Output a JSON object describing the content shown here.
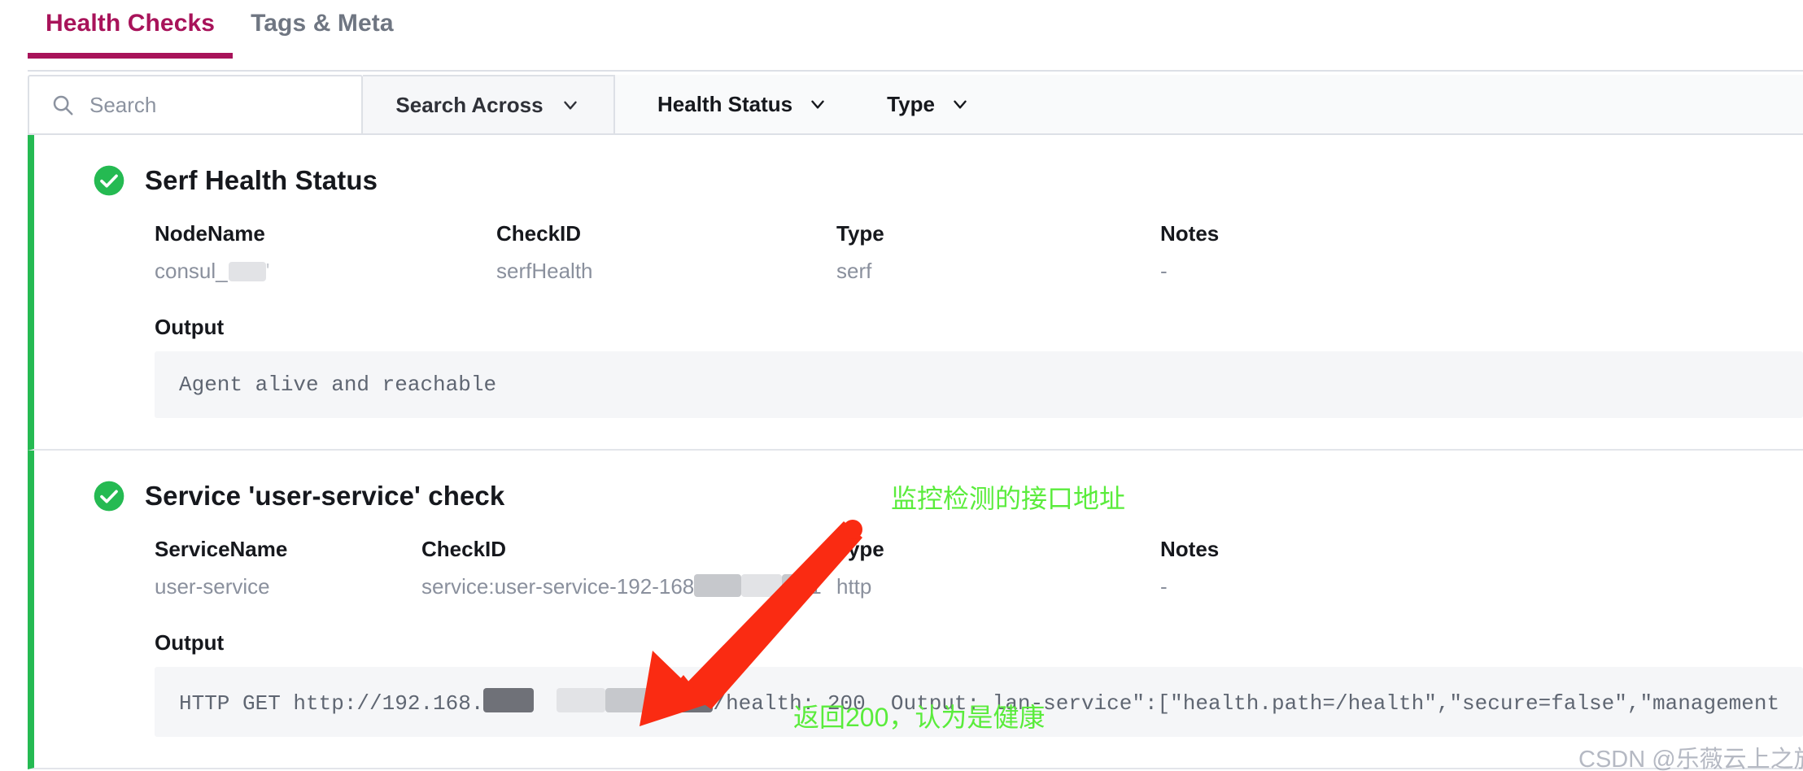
{
  "tabs": [
    {
      "label": "Health Checks",
      "active": true
    },
    {
      "label": "Tags & Meta",
      "active": false
    }
  ],
  "filters": {
    "search_placeholder": "Search",
    "search_value": "",
    "search_across_label": "Search Across",
    "health_status_label": "Health Status",
    "type_label": "Type"
  },
  "columns": {
    "node_name": "NodeName",
    "service_name": "ServiceName",
    "check_id": "CheckID",
    "type": "Type",
    "notes": "Notes",
    "output": "Output"
  },
  "checks": [
    {
      "title": "Serf Health Status",
      "status": "passing",
      "first_label": "NodeName",
      "first_value": "consul_",
      "check_id": "serfHealth",
      "type": "serf",
      "notes": "-",
      "output": "Agent alive and reachable"
    },
    {
      "title": "Service 'user-service' check",
      "status": "passing",
      "first_label": "ServiceName",
      "first_value": "user-service",
      "check_id": "service:user-service-192-168",
      "check_id_suffix": "1",
      "type": "http",
      "notes": "-",
      "output_prefix": "HTTP GET http://192.168.",
      "output_suffix": "/health: 200  Output: lan-service\":[\"health.path=/health\",\"secure=false\",\"management"
    }
  ],
  "annotations": [
    {
      "text": "监控检测的接口地址",
      "color": "#5aec3c"
    },
    {
      "text": "返回200，认为是健康",
      "color": "#5aec3c"
    }
  ],
  "watermark": {
    "text": "CSDN @乐薇云上之旅材t"
  },
  "colors": {
    "accent": "#a8135a",
    "passing": "#25ba52",
    "annotation": "#5aec3c",
    "arrow": "#fa2b12"
  }
}
